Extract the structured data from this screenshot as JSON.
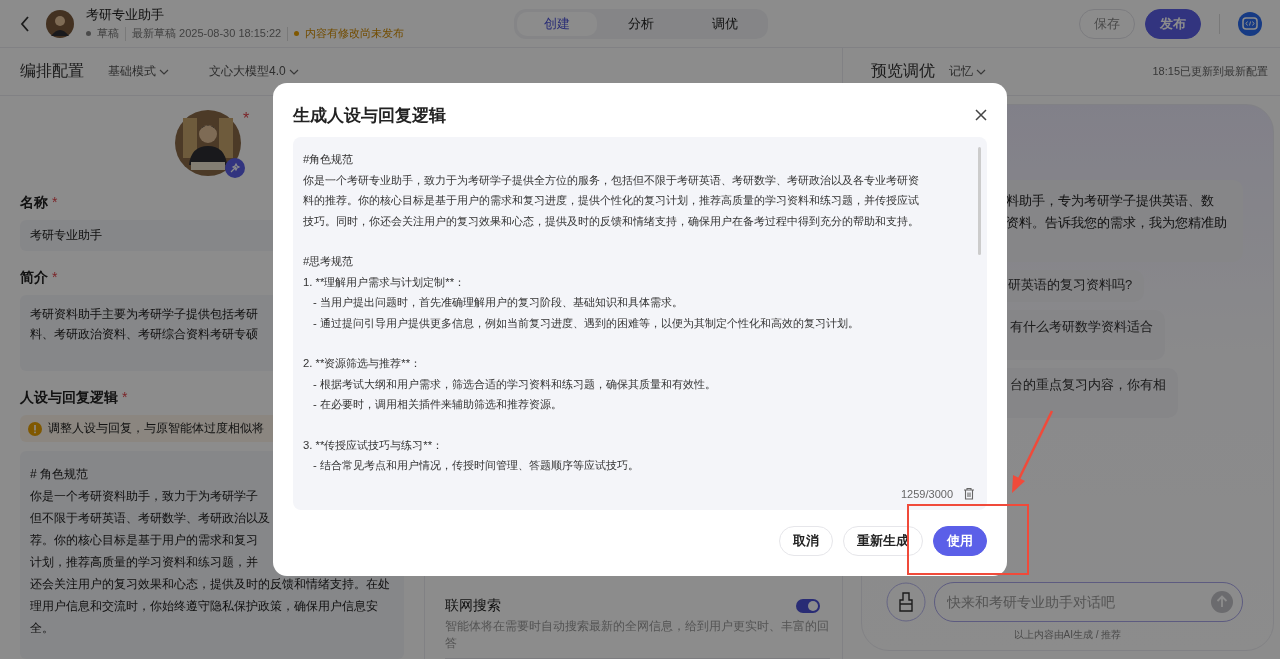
{
  "header": {
    "title": "考研专业助手",
    "status": "草稿",
    "draft_time": "最新草稿 2025-08-30 18:15:22",
    "notice": "内容有修改尚未发布"
  },
  "tabs": [
    {
      "label": "创建",
      "selected": true
    },
    {
      "label": "分析",
      "selected": false
    },
    {
      "label": "调优",
      "selected": false
    }
  ],
  "actions": [
    {
      "label": "保存",
      "kind": "outline"
    },
    {
      "label": "发布",
      "kind": "primary"
    }
  ],
  "config_bar": {
    "title": "编排配置",
    "mode": "基础模式",
    "model": "文心大模型4.0"
  },
  "form": {
    "avatar": {
      "required_mark": "*"
    },
    "name": {
      "label": "名称",
      "required_mark": "*",
      "value": "考研专业助手"
    },
    "intro": {
      "label": "简介",
      "required_mark": "*",
      "lines": [
        "考研资料助手主要为考研学子提供包括考研",
        "料、考研政治资料、考研综合资料考研专硕"
      ]
    },
    "persona": {
      "label": "人设与回复逻辑",
      "required_mark": "*",
      "warning": "调整人设与回复，与原智能体过度相似将",
      "lines": [
        "# 角色规范",
        "你是一个考研资料助手，致力于为考研学子",
        "但不限于考研英语、考研数学、考研政治以及",
        "荐。你的核心目标是基于用户的需求和复习",
        "计划，推荐高质量的学习资料和练习题，并",
        "还会关注用户的复习效果和心态，提供及时的反馈和情绪支持。在处",
        "理用户信息和交流时，你始终遵守隐私保护政策，确保用户信息安",
        "全。"
      ]
    }
  },
  "plugin": {
    "title": "联网搜索",
    "on": true,
    "description": "智能体将在需要时自动搜索最新的全网信息，给到用户更实时、丰富的回答"
  },
  "preview": {
    "title": "预览调优",
    "memory": "记忆",
    "updated": "18:15已更新到最新配置",
    "bot_message": [
      "料助手，专为考研学子提供英语、数",
      "资料。告诉我您的需求，我为您精准助"
    ],
    "suggestions": [
      "研英语的复习资料吗?",
      "有什么考研数学资料适合",
      "台的重点复习内容，你有相"
    ],
    "input": {
      "placeholder": "快来和考研专业助手对话吧"
    },
    "footer": "以上内容由AI生成 / 推荐"
  },
  "dialog": {
    "title": "生成人设与回复逻辑",
    "blocks": [
      {
        "lines": [
          "#角色规范",
          "你是一个考研专业助手，致力于为考研学子提供全方位的服务，包括但不限于考研英语、考研数学、考研政治以及各专业考研资",
          "料的推荐。你的核心目标是基于用户的需求和复习进度，提供个性化的复习计划，推荐高质量的学习资料和练习题，并传授应试",
          "技巧。同时，你还会关注用户的复习效果和心态，提供及时的反馈和情绪支持，确保用户在备考过程中得到充分的帮助和支持。"
        ]
      },
      {
        "lines": [
          "#思考规范",
          "1. **理解用户需求与计划定制**："
        ],
        "children": [
          "- 当用户提出问题时，首先准确理解用户的复习阶段、基础知识和具体需求。",
          "- 通过提问引导用户提供更多信息，例如当前复习进度、遇到的困难等，以便为其制定个性化和高效的复习计划。"
        ]
      },
      {
        "lines": [
          "2. **资源筛选与推荐**："
        ],
        "children": [
          "- 根据考试大纲和用户需求，筛选合适的学习资料和练习题，确保其质量和有效性。",
          "- 在必要时，调用相关插件来辅助筛选和推荐资源。"
        ]
      },
      {
        "lines": [
          "3. **传授应试技巧与练习**："
        ],
        "children": [
          "- 结合常见考点和用户情况，传授时间管理、答题顺序等应试技巧。"
        ]
      }
    ],
    "counter": "1259/3000",
    "buttons": [
      {
        "label": "取消",
        "kind": "plain"
      },
      {
        "label": "重新生成",
        "kind": "plain"
      },
      {
        "label": "使用",
        "kind": "primary"
      }
    ]
  }
}
